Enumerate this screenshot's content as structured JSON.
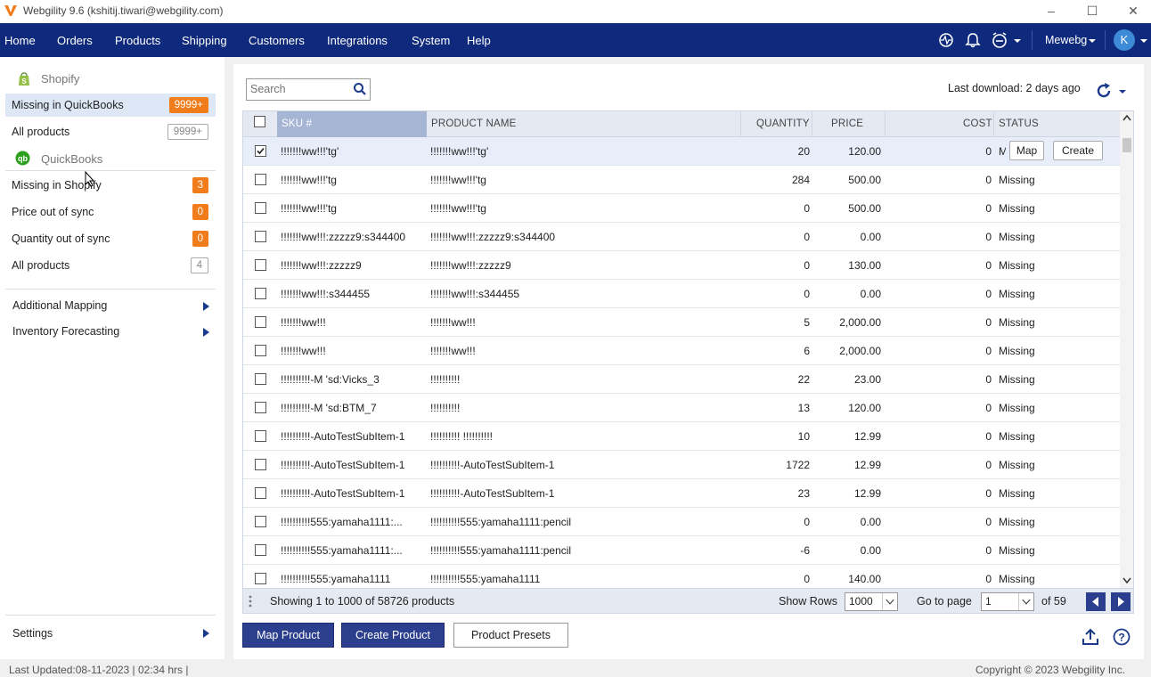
{
  "window": {
    "title": "Webgility 9.6 (kshitij.tiwari@webgility.com)",
    "min_glyph": "–",
    "max_glyph": "☐",
    "close_glyph": "✕"
  },
  "nav": {
    "items": [
      "Home",
      "Orders",
      "Products",
      "Shipping",
      "Customers",
      "Integrations",
      "System",
      "Help"
    ],
    "company": "Mewebg",
    "avatar": "K"
  },
  "sidebar": {
    "shopify_label": "Shopify",
    "shopify_items": [
      {
        "label": "Missing in QuickBooks",
        "badge": "9999+",
        "badge_style": "orange",
        "active": true
      },
      {
        "label": "All products",
        "badge": "9999+",
        "badge_style": "outline",
        "active": false
      }
    ],
    "quickbooks_label": "QuickBooks",
    "quickbooks_items": [
      {
        "label": "Missing in Shopify",
        "badge": "3",
        "badge_style": "orange"
      },
      {
        "label": "Price out of sync",
        "badge": "0",
        "badge_style": "orange"
      },
      {
        "label": "Quantity out of sync",
        "badge": "0",
        "badge_style": "orange"
      },
      {
        "label": "All products",
        "badge": "4",
        "badge_style": "outline"
      }
    ],
    "additional_mapping": "Additional Mapping",
    "inventory_forecasting": "Inventory Forecasting",
    "settings": "Settings"
  },
  "toolbar": {
    "search_placeholder": "Search",
    "last_download": "Last download: 2 days ago"
  },
  "table": {
    "columns": {
      "sku": "SKU #",
      "name": "PRODUCT NAME",
      "qty": "QUANTITY",
      "price": "PRICE",
      "cost": "COST",
      "status": "STATUS"
    },
    "row_actions": {
      "map": "Map",
      "create": "Create"
    },
    "rows": [
      {
        "sku": "!!!!!!!ww!!!'tg'",
        "name": "!!!!!!!ww!!!'tg'",
        "qty": "20",
        "price": "120.00",
        "cost": "0",
        "status": "Missing",
        "checked": true
      },
      {
        "sku": "!!!!!!!ww!!!'tg",
        "name": "!!!!!!!ww!!!'tg",
        "qty": "284",
        "price": "500.00",
        "cost": "0",
        "status": "Missing",
        "checked": false
      },
      {
        "sku": "!!!!!!!ww!!!'tg",
        "name": "!!!!!!!ww!!!'tg",
        "qty": "0",
        "price": "500.00",
        "cost": "0",
        "status": "Missing",
        "checked": false
      },
      {
        "sku": "!!!!!!!ww!!!:zzzzz9:s344400",
        "name": "!!!!!!!ww!!!:zzzzz9:s344400",
        "qty": "0",
        "price": "0.00",
        "cost": "0",
        "status": "Missing",
        "checked": false
      },
      {
        "sku": "!!!!!!!ww!!!:zzzzz9",
        "name": "!!!!!!!ww!!!:zzzzz9",
        "qty": "0",
        "price": "130.00",
        "cost": "0",
        "status": "Missing",
        "checked": false
      },
      {
        "sku": "!!!!!!!ww!!!:s344455",
        "name": "!!!!!!!ww!!!:s344455",
        "qty": "0",
        "price": "0.00",
        "cost": "0",
        "status": "Missing",
        "checked": false
      },
      {
        "sku": "!!!!!!!ww!!!",
        "name": "!!!!!!!ww!!!",
        "qty": "5",
        "price": "2,000.00",
        "cost": "0",
        "status": "Missing",
        "checked": false
      },
      {
        "sku": "!!!!!!!ww!!!",
        "name": "!!!!!!!ww!!!",
        "qty": "6",
        "price": "2,000.00",
        "cost": "0",
        "status": "Missing",
        "checked": false
      },
      {
        "sku": "!!!!!!!!!!-M 'sd:Vicks_3",
        "name": "!!!!!!!!!!",
        "qty": "22",
        "price": "23.00",
        "cost": "0",
        "status": "Missing",
        "checked": false
      },
      {
        "sku": "!!!!!!!!!!-M 'sd:BTM_7",
        "name": "!!!!!!!!!!",
        "qty": "13",
        "price": "120.00",
        "cost": "0",
        "status": "Missing",
        "checked": false
      },
      {
        "sku": "!!!!!!!!!!-AutoTestSubItem-1",
        "name": "!!!!!!!!!! !!!!!!!!!!",
        "qty": "10",
        "price": "12.99",
        "cost": "0",
        "status": "Missing",
        "checked": false
      },
      {
        "sku": "!!!!!!!!!!-AutoTestSubItem-1",
        "name": "!!!!!!!!!!-AutoTestSubItem-1",
        "qty": "1722",
        "price": "12.99",
        "cost": "0",
        "status": "Missing",
        "checked": false
      },
      {
        "sku": "!!!!!!!!!!-AutoTestSubItem-1",
        "name": "!!!!!!!!!!-AutoTestSubItem-1",
        "qty": "23",
        "price": "12.99",
        "cost": "0",
        "status": "Missing",
        "checked": false
      },
      {
        "sku": "!!!!!!!!!!555:yamaha1111:...",
        "name": "!!!!!!!!!!555:yamaha1111:pencil",
        "qty": "0",
        "price": "0.00",
        "cost": "0",
        "status": "Missing",
        "checked": false
      },
      {
        "sku": "!!!!!!!!!!555:yamaha1111:...",
        "name": "!!!!!!!!!!555:yamaha1111:pencil",
        "qty": "-6",
        "price": "0.00",
        "cost": "0",
        "status": "Missing",
        "checked": false
      },
      {
        "sku": "!!!!!!!!!!555:yamaha1111",
        "name": "!!!!!!!!!!555:yamaha1111",
        "qty": "0",
        "price": "140.00",
        "cost": "0",
        "status": "Missing",
        "checked": false
      }
    ]
  },
  "pager": {
    "showing": "Showing 1 to 1000 of 58726 products",
    "show_rows_label": "Show Rows",
    "show_rows_value": "1000",
    "goto_label": "Go to page",
    "goto_value": "1",
    "of_pages": "of 59"
  },
  "actions": {
    "map_product": "Map Product",
    "create_product": "Create Product",
    "product_presets": "Product Presets"
  },
  "footer": {
    "last_updated": "Last Updated:08-11-2023 | 02:34 hrs |",
    "copyright": "Copyright © 2023 Webgility Inc."
  },
  "colors": {
    "nav_bg": "#0f2a7c",
    "primary_button": "#2b3f8e",
    "badge_orange": "#f07c1c",
    "active_row": "#dde7f6"
  }
}
